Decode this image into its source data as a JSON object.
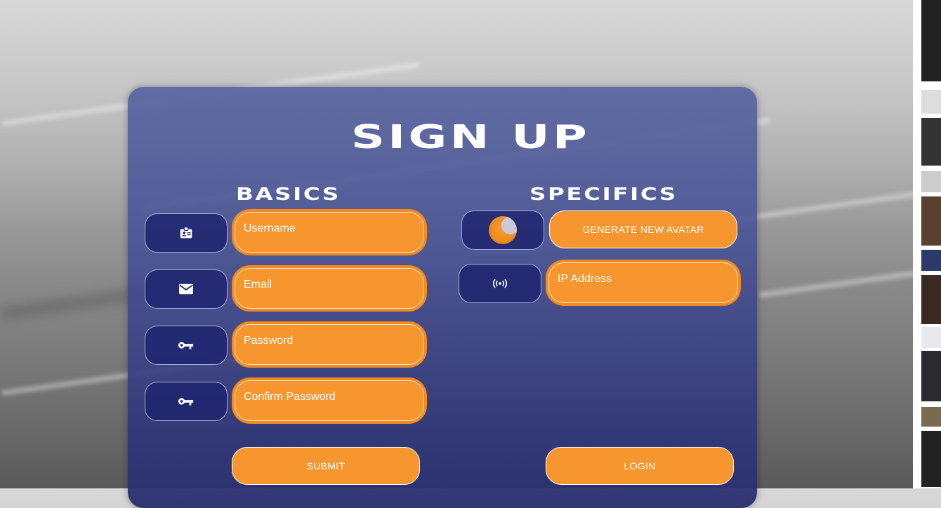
{
  "form": {
    "title": "SIGN UP",
    "basics_title": "BASICS",
    "specifics_title": "SPECIFICS",
    "username_placeholder": "Username",
    "email_placeholder": "Email",
    "password_placeholder": "Password",
    "confirm_password_placeholder": "Confirm Password",
    "ip_placeholder": "IP Address",
    "generate_avatar_label": "GENERATE NEW AVATAR",
    "submit_label": "SUBMIT",
    "login_label": "LOGIN"
  },
  "icons": {
    "username": "id-badge-icon",
    "email": "mail-icon",
    "password": "key-icon",
    "confirm_password": "key-icon",
    "ip": "broadcast-icon",
    "avatar": "avatar-image"
  },
  "colors": {
    "accent": "#f7962f",
    "card": "#4a5598",
    "icon_box": "#1e246e"
  }
}
